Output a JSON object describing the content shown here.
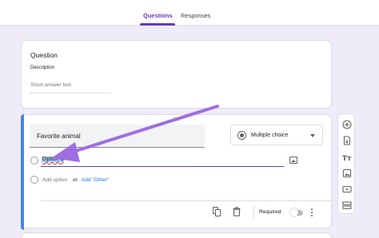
{
  "tabs": [
    {
      "label": "Questions",
      "active": true
    },
    {
      "label": "Responses",
      "active": false
    }
  ],
  "question_card": {
    "title": "Question",
    "description": "Description",
    "answer_placeholder": "Short-answer text"
  },
  "editor_card": {
    "question_title": "Favorite animal",
    "question_type": "Multiple choice",
    "option_1": "Option 1",
    "add_option": "Add option",
    "or": "or",
    "add_other": "Add \"Other\"",
    "required_label": "Required",
    "required_on": false
  },
  "toolbar": {
    "tools": [
      "add-question-icon",
      "import-questions-icon",
      "add-title-icon",
      "add-image-icon",
      "add-video-icon",
      "add-section-icon"
    ]
  },
  "colors": {
    "accent": "#673ab7",
    "active_bar": "#4285f4",
    "link": "#1a73e8",
    "background": "#f0ebf8",
    "annotation_arrow": "#a06ee0"
  }
}
